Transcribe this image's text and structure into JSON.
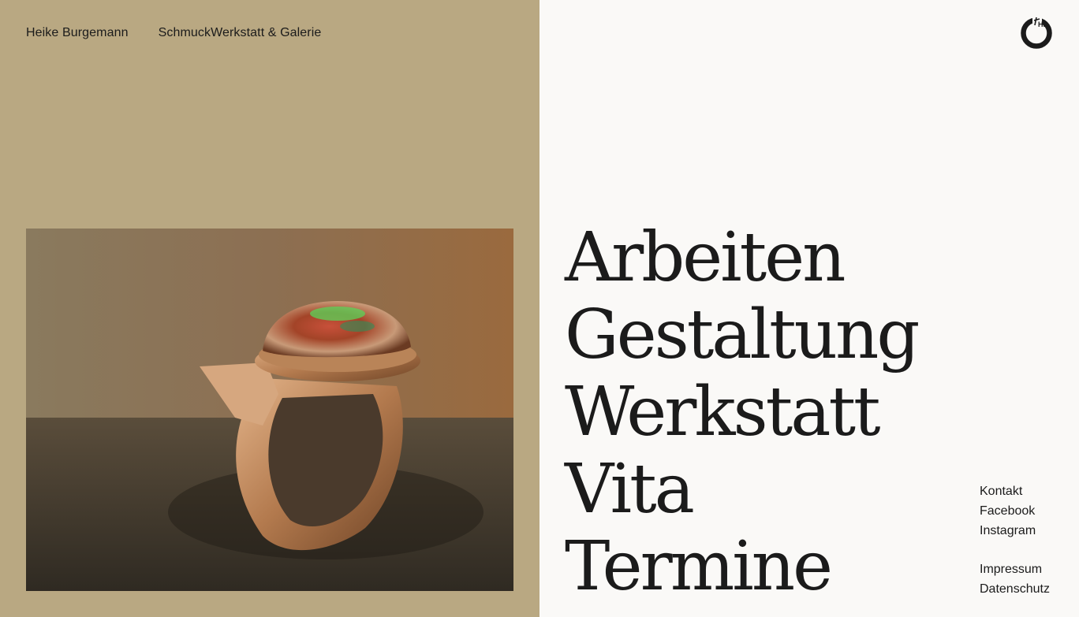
{
  "header": {
    "owner_name": "Heike Burgemann",
    "studio_name": "SchmuckWerkstatt & Galerie"
  },
  "logo": {
    "icon": "hb-ring-logo-icon",
    "monogram": "HB"
  },
  "hero_image": {
    "subject": "ring-with-opal-icon"
  },
  "main_menu": {
    "items": [
      {
        "label": "Arbeiten"
      },
      {
        "label": "Gestaltung"
      },
      {
        "label": "Werkstatt"
      },
      {
        "label": "Vita"
      },
      {
        "label": "Termine"
      }
    ]
  },
  "side_links": {
    "social": [
      {
        "label": "Kontakt"
      },
      {
        "label": "Facebook"
      },
      {
        "label": "Instagram"
      }
    ],
    "legal": [
      {
        "label": "Impressum"
      },
      {
        "label": "Datenschutz"
      }
    ]
  },
  "colors": {
    "left_panel": "#b9a882",
    "right_panel": "#faf9f7",
    "text": "#1b1b1b"
  }
}
